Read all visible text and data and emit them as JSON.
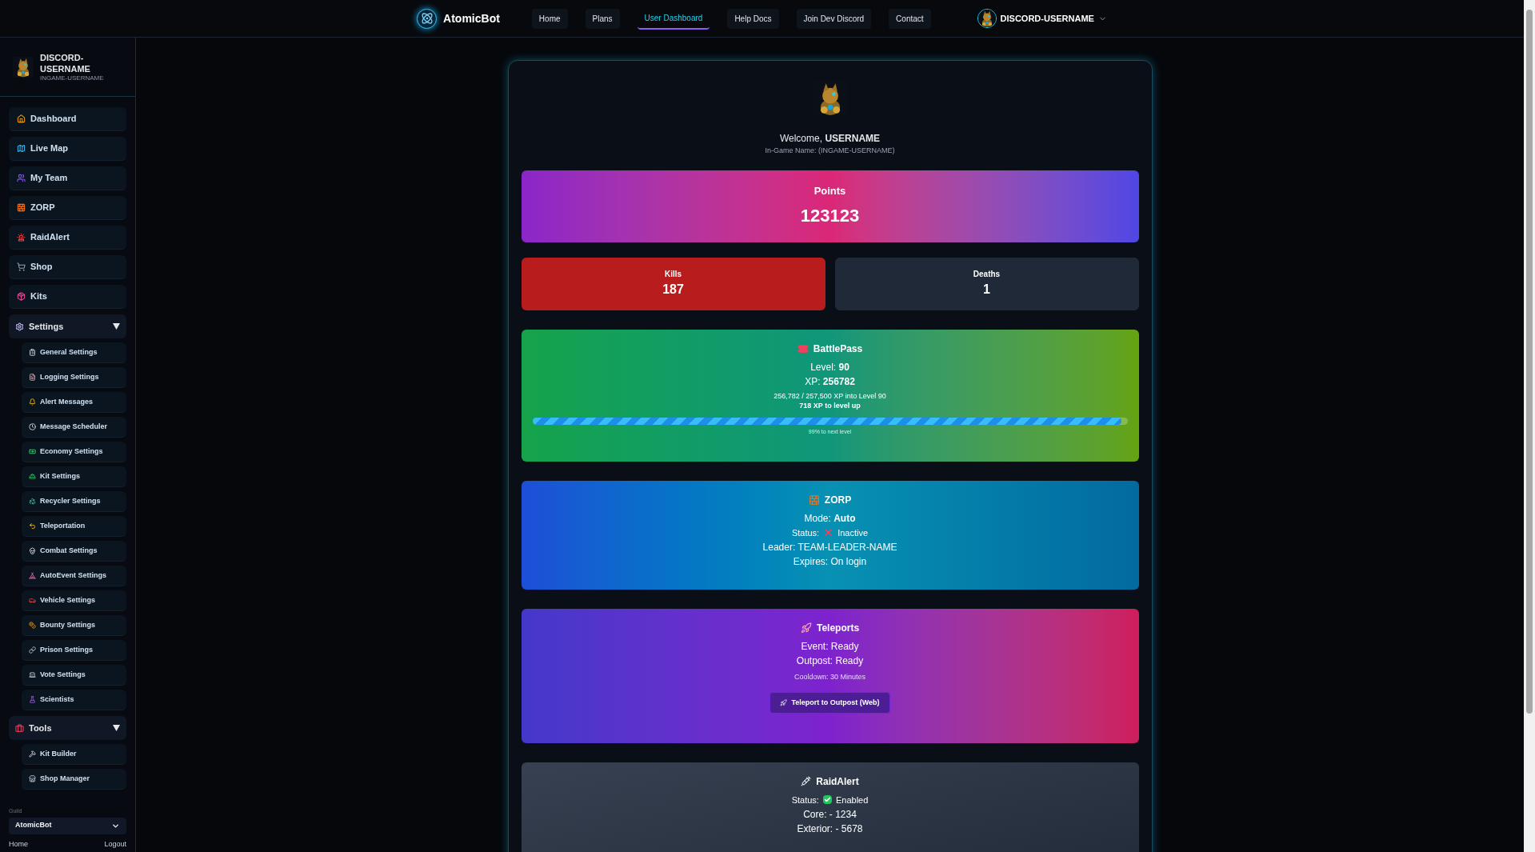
{
  "nav": {
    "brand": "AtomicBot",
    "links": [
      {
        "label": "Home",
        "selected": false
      },
      {
        "label": "Plans",
        "selected": false
      },
      {
        "label": "User Dashboard",
        "selected": true
      },
      {
        "label": "Help Docs",
        "selected": false
      },
      {
        "label": "Join Dev Discord",
        "selected": false
      },
      {
        "label": "Contact",
        "selected": false
      }
    ],
    "user": "DISCORD-USERNAME"
  },
  "sidebar": {
    "profile": {
      "name": "DISCORD-USERNAME",
      "ingame": "INGAME-USERNAME"
    },
    "items": [
      {
        "label": "Dashboard",
        "kind": "link"
      },
      {
        "label": "Live Map",
        "kind": "link"
      },
      {
        "label": "My Team",
        "kind": "link"
      },
      {
        "label": "ZORP",
        "kind": "link"
      },
      {
        "label": "RaidAlert",
        "kind": "link"
      },
      {
        "label": "Shop",
        "kind": "link"
      },
      {
        "label": "Kits",
        "kind": "link"
      },
      {
        "label": "Settings",
        "kind": "group",
        "expanded": true,
        "children": [
          {
            "label": "General Settings"
          },
          {
            "label": "Logging Settings"
          },
          {
            "label": "Alert Messages"
          },
          {
            "label": "Message Scheduler"
          },
          {
            "label": "Economy Settings"
          },
          {
            "label": "Kit Settings"
          },
          {
            "label": "Recycler Settings"
          },
          {
            "label": "Teleportation"
          },
          {
            "label": "Combat Settings"
          },
          {
            "label": "AutoEvent Settings"
          },
          {
            "label": "Vehicle Settings"
          },
          {
            "label": "Bounty Settings"
          },
          {
            "label": "Prison Settings"
          },
          {
            "label": "Vote Settings"
          },
          {
            "label": "Scientists"
          }
        ]
      },
      {
        "label": "Tools",
        "kind": "group",
        "expanded": true,
        "children": [
          {
            "label": "Kit Builder"
          },
          {
            "label": "Shop Manager"
          }
        ]
      }
    ],
    "guild": {
      "label": "Guild",
      "value": "AtomicBot"
    },
    "footer": [
      "Home",
      "Logout"
    ]
  },
  "welcome": {
    "greeting": "Welcome, **USERNAME**",
    "ingame": "In-Game Name: (INGAME-USERNAME)"
  },
  "points": {
    "label": "Points",
    "value": "123123"
  },
  "stats": [
    {
      "kind": "kills",
      "label": "Kills",
      "value": "187"
    },
    {
      "kind": "deaths",
      "label": "Deaths",
      "value": "1"
    }
  ],
  "cards": [
    {
      "kind": "battlepass",
      "title": "BattlePass",
      "lines": [
        "Level: **90**",
        "XP: **256782**"
      ],
      "detail": "256,782 / 257,500 XP into Level 90",
      "remaining": "718 XP to level up",
      "level": 0.99,
      "caption": "99% to next level"
    },
    {
      "kind": "zorp",
      "title": "ZORP",
      "lines": [
        "Mode: **Auto**"
      ],
      "status": {
        "label": "Status:",
        "value": "Inactive",
        "on": false
      },
      "after": [
        "Leader: TEAM-LEADER-NAME",
        "Expires: On login"
      ]
    },
    {
      "kind": "teleports",
      "title": "Teleports",
      "lines": [
        "Event: Ready",
        "Outpost: Ready"
      ],
      "cooldown": "Cooldown: 30 Minutes",
      "button": "Teleport to Outpost (Web)"
    },
    {
      "kind": "raidalert",
      "title": "RaidAlert",
      "status": {
        "label": "Status:",
        "value": "Enabled",
        "on": true
      },
      "after": [
        "Core: - 1234",
        "Exterior: - 5678"
      ]
    }
  ]
}
